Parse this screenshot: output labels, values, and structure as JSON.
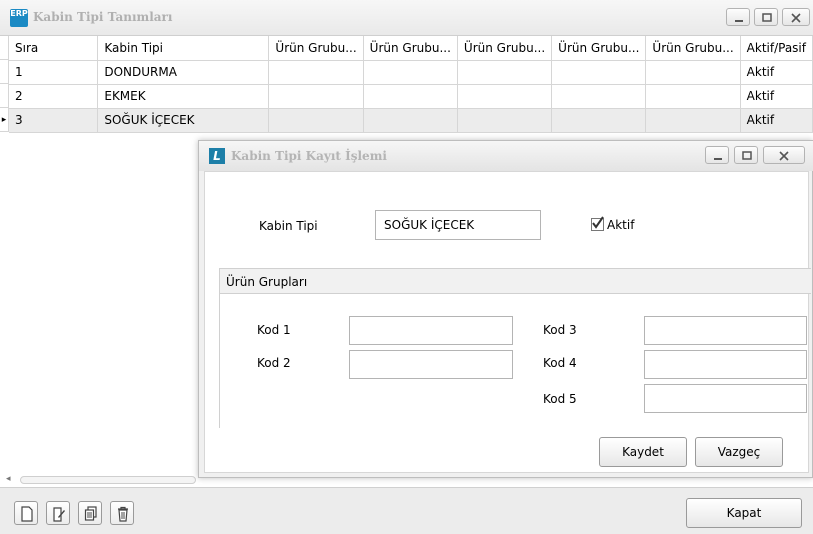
{
  "window": {
    "title": "Kabin Tipi Tanımları",
    "icon_text": "ERP"
  },
  "grid": {
    "columns": [
      "Sıra",
      "Kabin Tipi",
      "Ürün Grubu...",
      "Ürün Grubu...",
      "Ürün Grubu...",
      "Ürün Grubu...",
      "Ürün Grubu...",
      "Aktif/Pasif"
    ],
    "rows": [
      {
        "sira": "1",
        "kabin_tipi": "DONDURMA",
        "durum": "Aktif"
      },
      {
        "sira": "2",
        "kabin_tipi": "EKMEK",
        "durum": "Aktif"
      },
      {
        "sira": "3",
        "kabin_tipi": "SOĞUK İÇECEK",
        "durum": "Aktif"
      }
    ],
    "selected_row_indicator": "▸"
  },
  "toolbar": {
    "icons": [
      "new-document-icon",
      "edit-icon",
      "copy-icon",
      "delete-icon"
    ],
    "close_label": "Kapat"
  },
  "dialog": {
    "title": "Kabin Tipi Kayıt İşlemi",
    "icon_text": "L",
    "kabin_tipi_label": "Kabin Tipi",
    "kabin_tipi_value": "SOĞUK İÇECEK",
    "aktif_label": "Aktif",
    "aktif_checked": true,
    "group_title": "Ürün Grupları",
    "kod1_label": "Kod 1",
    "kod2_label": "Kod 2",
    "kod3_label": "Kod 3",
    "kod4_label": "Kod 4",
    "kod5_label": "Kod 5",
    "kod1_value": "",
    "kod2_value": "",
    "kod3_value": "",
    "kod4_value": "",
    "kod5_value": "",
    "save_label": "Kaydet",
    "cancel_label": "Vazgeç"
  }
}
